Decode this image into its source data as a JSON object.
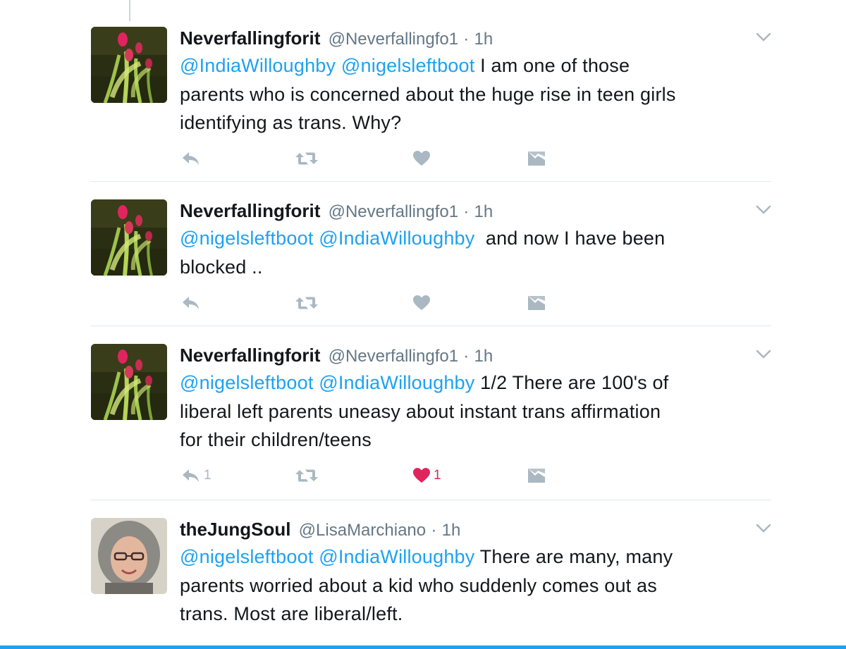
{
  "tweets": [
    {
      "name": "Neverfallingforit",
      "handle": "@Neverfallingfo1",
      "dot": "·",
      "time": "1h",
      "avatar": "tulip-avatar",
      "mention_1": "@IndiaWilloughby",
      "mention_2": "@nigelsleftboot",
      "body_1": "I am one of those",
      "body_2": "parents who is concerned about the huge rise in teen girls",
      "body_3": "identifying as trans. Why?",
      "reply_count": "",
      "like_count": "",
      "liked": false
    },
    {
      "name": "Neverfallingforit",
      "handle": "@Neverfallingfo1",
      "dot": "·",
      "time": "1h",
      "avatar": "tulip-avatar",
      "mention_1": "@nigelsleftboot",
      "mention_2": "@IndiaWilloughby",
      "body_1": "and now I have been",
      "body_2": "blocked ..",
      "reply_count": "",
      "like_count": "",
      "liked": false
    },
    {
      "name": "Neverfallingforit",
      "handle": "@Neverfallingfo1",
      "dot": "·",
      "time": "1h",
      "avatar": "tulip-avatar",
      "mention_1": "@nigelsleftboot",
      "mention_2": "@IndiaWilloughby",
      "body_1": "1/2 There are 100's of",
      "body_2": "liberal left parents uneasy about instant trans affirmation",
      "body_3": "for their children/teens",
      "reply_count": "1",
      "like_count": "1",
      "liked": true
    },
    {
      "name": "theJungSoul",
      "handle": "@LisaMarchiano",
      "dot": "·",
      "time": "1h",
      "avatar": "woman-portrait-avatar",
      "mention_1": "@nigelsleftboot",
      "mention_2": "@IndiaWilloughby",
      "body_1": "There are many, many",
      "body_2": "parents worried about a kid who suddenly comes out as",
      "body_3": "trans. Most are liberal/left."
    }
  ],
  "icons": {
    "reply": "reply-icon",
    "retweet": "retweet-icon",
    "like": "heart-icon",
    "dm": "direct-message-icon",
    "caret": "chevron-down-icon"
  },
  "colors": {
    "link": "#1da1f2",
    "muted": "#657786",
    "icon": "#aab8c2",
    "liked": "#e0245e",
    "divider": "#e1e8ed"
  }
}
